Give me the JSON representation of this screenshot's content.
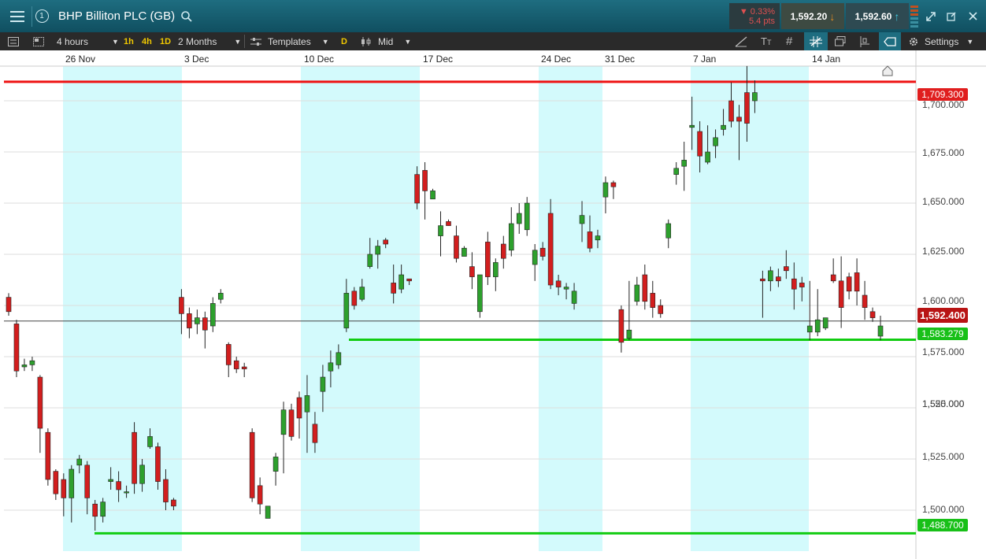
{
  "header": {
    "instrument": "BHP Billiton PLC (GB)",
    "badge": "1",
    "change_pct": "▼ 0.33%",
    "change_pts": "5.4 pts",
    "sell_price": "1,592.20",
    "buy_price": "1,592.60"
  },
  "toolbar": {
    "interval": "4 hours",
    "quick": [
      "1h",
      "4h",
      "1D"
    ],
    "range": "2 Months",
    "templates": "Templates",
    "d_label": "D",
    "price_type": "Mid",
    "settings": "Settings"
  },
  "colors": {
    "up": "#2da02d",
    "down": "#d21e1e",
    "band": "#d3fafc",
    "resistance": "#ee1111",
    "support": "#11cc11"
  },
  "chart_data": {
    "type": "candlestick",
    "ylim": [
      1480,
      1720
    ],
    "yticks": [
      "1,500.000",
      "1,525.000",
      "1,550.000",
      "1,575.000",
      "1,600.000",
      "1,625.000",
      "1,650.000",
      "1,675.000",
      "1,700.000"
    ],
    "xlabels": [
      "26 Nov",
      "3 Dec",
      "10 Dec",
      "17 Dec",
      "24 Dec",
      "31 Dec",
      "7 Jan",
      "14 Jan"
    ],
    "current_price": 1592.4,
    "current_label": "1,592.400",
    "levels": [
      {
        "value": 1709.3,
        "label": "1,709.300",
        "role": "resistance"
      },
      {
        "value": 1583.279,
        "label": "1,583.279",
        "role": "support"
      },
      {
        "value": 1488.7,
        "label": "1,488.700",
        "role": "support"
      }
    ],
    "candles": [
      [
        1604,
        1597,
        1606,
        1595
      ],
      [
        1591,
        1568,
        1593,
        1565
      ],
      [
        1570,
        1571,
        1574,
        1568
      ],
      [
        1571,
        1573,
        1575,
        1568
      ],
      [
        1565,
        1540,
        1566,
        1528
      ],
      [
        1538,
        1515,
        1540,
        1512
      ],
      [
        1519,
        1508,
        1520,
        1505
      ],
      [
        1515,
        1506,
        1518,
        1497
      ],
      [
        1506,
        1520,
        1522,
        1494
      ],
      [
        1522,
        1525,
        1527,
        1518
      ],
      [
        1522,
        1506,
        1524,
        1498
      ],
      [
        1503,
        1497,
        1505,
        1490
      ],
      [
        1497,
        1504,
        1506,
        1494
      ],
      [
        1514,
        1515,
        1521,
        1510
      ],
      [
        1514,
        1510,
        1519,
        1504
      ],
      [
        1509,
        1509,
        1512,
        1506
      ],
      [
        1538,
        1513,
        1543,
        1508
      ],
      [
        1513,
        1522,
        1525,
        1509
      ],
      [
        1531,
        1536,
        1540,
        1530
      ],
      [
        1531,
        1514,
        1533,
        1510
      ],
      [
        1515,
        1504,
        1520,
        1500
      ],
      [
        1505,
        1502,
        1506,
        1500
      ],
      [
        1604,
        1596,
        1608,
        1586
      ],
      [
        1596,
        1589,
        1599,
        1584
      ],
      [
        1591,
        1594,
        1598,
        1586
      ],
      [
        1594,
        1588,
        1597,
        1579
      ],
      [
        1590,
        1601,
        1604,
        1587
      ],
      [
        1603,
        1606,
        1608,
        1601
      ],
      [
        1581,
        1571,
        1582,
        1565
      ],
      [
        1573,
        1569,
        1575,
        1567
      ],
      [
        1570,
        1569,
        1572,
        1565
      ],
      [
        1538,
        1506,
        1540,
        1504
      ],
      [
        1512,
        1503,
        1516,
        1498
      ],
      [
        1496,
        1502,
        1495,
        1495
      ],
      [
        1519,
        1526,
        1528,
        1512
      ],
      [
        1537,
        1549,
        1553,
        1518
      ],
      [
        1549,
        1536,
        1552,
        1534
      ],
      [
        1555,
        1545,
        1558,
        1535
      ],
      [
        1548,
        1556,
        1566,
        1528
      ],
      [
        1542,
        1533,
        1548,
        1528
      ],
      [
        1558,
        1565,
        1571,
        1548
      ],
      [
        1568,
        1572,
        1578,
        1560
      ],
      [
        1571,
        1577,
        1581,
        1569
      ],
      [
        1589,
        1606,
        1613,
        1587
      ],
      [
        1607,
        1600,
        1609,
        1598
      ],
      [
        1603,
        1609,
        1613,
        1602
      ],
      [
        1619,
        1625,
        1633,
        1618
      ],
      [
        1625,
        1629,
        1632,
        1618
      ],
      [
        1632,
        1630,
        1633,
        1628
      ],
      [
        1611,
        1606,
        1620,
        1601
      ],
      [
        1608,
        1615,
        1620,
        1606
      ],
      [
        1613,
        1612,
        1613,
        1610
      ],
      [
        1664,
        1650,
        1668,
        1647
      ],
      [
        1666,
        1656,
        1670,
        1642
      ],
      [
        1652,
        1656,
        1657,
        1652
      ],
      [
        1634,
        1639,
        1646,
        1624
      ],
      [
        1641,
        1639,
        1642,
        1639
      ],
      [
        1634,
        1623,
        1639,
        1621
      ],
      [
        1624,
        1628,
        1629,
        1625
      ],
      [
        1619,
        1614,
        1626,
        1608
      ],
      [
        1597,
        1615,
        1606,
        1594
      ],
      [
        1631,
        1614,
        1636,
        1610
      ],
      [
        1614,
        1621,
        1623,
        1607
      ],
      [
        1630,
        1623,
        1634,
        1618
      ],
      [
        1627,
        1640,
        1648,
        1624
      ],
      [
        1640,
        1645,
        1650,
        1635
      ],
      [
        1637,
        1650,
        1653,
        1634
      ],
      [
        1620,
        1627,
        1630,
        1612
      ],
      [
        1628,
        1624,
        1631,
        1622
      ],
      [
        1645,
        1610,
        1652,
        1608
      ],
      [
        1612,
        1609,
        1615,
        1605
      ],
      [
        1608,
        1609,
        1611,
        1603
      ],
      [
        1601,
        1607,
        1611,
        1598
      ],
      [
        1640,
        1644,
        1651,
        1631
      ],
      [
        1636,
        1628,
        1644,
        1626
      ],
      [
        1632,
        1634,
        1637,
        1628
      ],
      [
        1653,
        1660,
        1663,
        1645
      ],
      [
        1660,
        1658,
        1661,
        1652
      ],
      [
        1598,
        1582,
        1600,
        1577
      ],
      [
        1584,
        1588,
        1612,
        1583
      ],
      [
        1602,
        1610,
        1614,
        1600
      ],
      [
        1615,
        1602,
        1620,
        1598
      ],
      [
        1606,
        1599,
        1612,
        1594
      ],
      [
        1600,
        1596,
        1603,
        1594
      ],
      [
        1633,
        1640,
        1642,
        1628
      ],
      [
        1664,
        1667,
        1670,
        1659
      ],
      [
        1668,
        1671,
        1680,
        1656
      ],
      [
        1687,
        1688,
        1702,
        1676
      ],
      [
        1685,
        1673,
        1690,
        1665
      ],
      [
        1670,
        1675,
        1688,
        1669
      ],
      [
        1678,
        1682,
        1686,
        1672
      ],
      [
        1686,
        1688,
        1696,
        1683
      ],
      [
        1700,
        1690,
        1709,
        1687
      ],
      [
        1692,
        1690,
        1698,
        1671
      ],
      [
        1704,
        1689,
        1717,
        1680
      ],
      [
        1700,
        1704,
        1710,
        1694
      ],
      [
        1613,
        1612,
        1617,
        1594
      ],
      [
        1612,
        1617,
        1619,
        1607
      ],
      [
        1614,
        1612,
        1618,
        1609
      ],
      [
        1619,
        1617,
        1627,
        1613
      ],
      [
        1613,
        1608,
        1621,
        1598
      ],
      [
        1611,
        1609,
        1614,
        1602
      ],
      [
        1587,
        1590,
        1612,
        1583
      ],
      [
        1587,
        1593,
        1608,
        1585
      ],
      [
        1589,
        1594,
        1592,
        1588
      ],
      [
        1615,
        1612,
        1623,
        1611
      ],
      [
        1612,
        1599,
        1624,
        1589
      ],
      [
        1614,
        1607,
        1616,
        1603
      ],
      [
        1616,
        1607,
        1623,
        1600
      ],
      [
        1605,
        1599,
        1612,
        1593
      ],
      [
        1597,
        1594,
        1599,
        1592
      ],
      [
        1585,
        1590,
        1595,
        1583
      ]
    ]
  }
}
